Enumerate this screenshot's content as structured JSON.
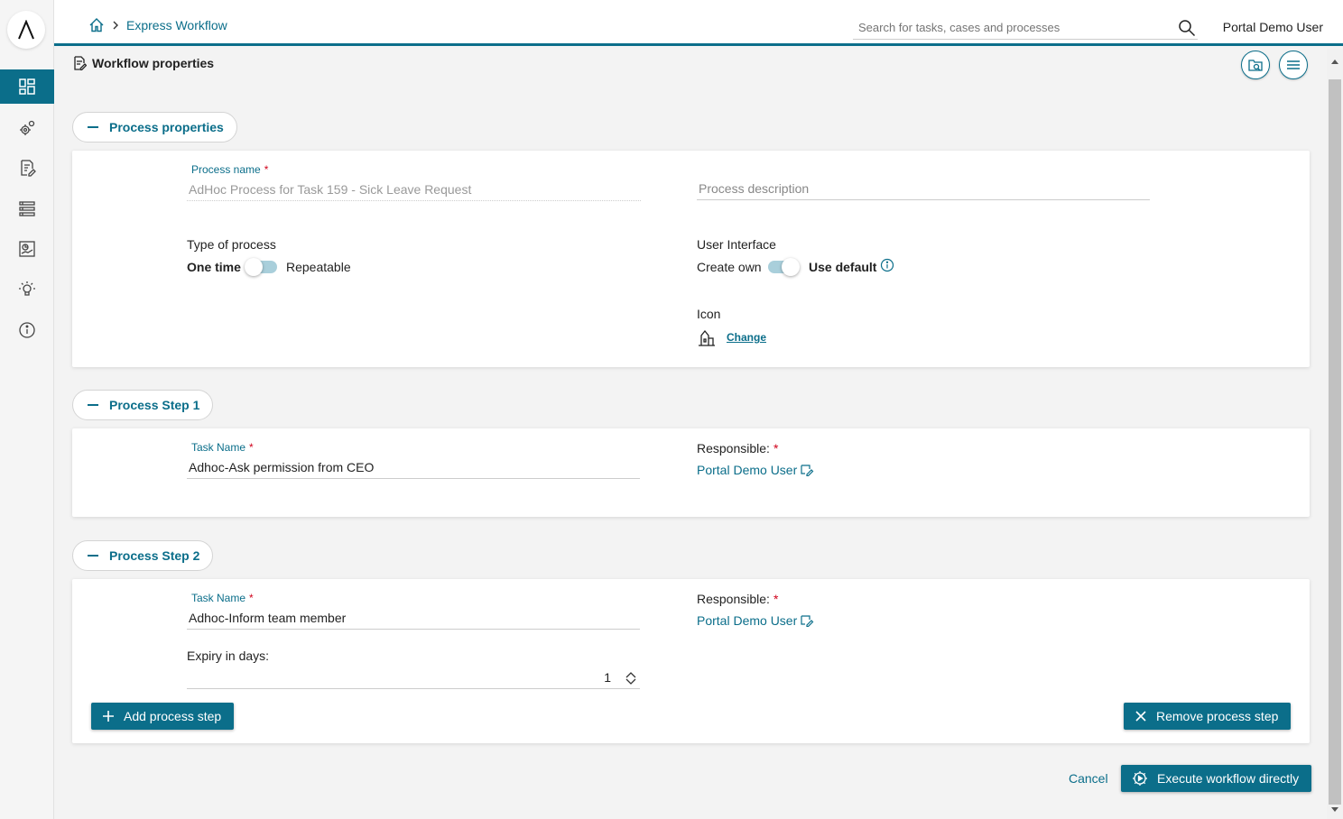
{
  "header": {
    "breadcrumb": "Express Workflow",
    "search_placeholder": "Search for tasks, cases and processes",
    "user": "Portal Demo User"
  },
  "sidebar": {
    "items": [
      {
        "icon": "dashboard-icon",
        "active": true
      },
      {
        "icon": "gears-icon"
      },
      {
        "icon": "task-edit-icon"
      },
      {
        "icon": "list-icon"
      },
      {
        "icon": "statistics-icon"
      },
      {
        "icon": "lightbulb-icon"
      },
      {
        "icon": "info-icon"
      }
    ]
  },
  "page": {
    "title": "Workflow properties"
  },
  "process_properties": {
    "section_label": "Process properties",
    "process_name_label": "Process name",
    "process_name_value": "AdHoc Process for Task 159 - Sick Leave Request",
    "process_description_placeholder": "Process description",
    "type_label": "Type of process",
    "type_option_left": "One time",
    "type_option_right": "Repeatable",
    "ui_label": "User Interface",
    "ui_option_left": "Create own",
    "ui_option_right": "Use default",
    "icon_label": "Icon",
    "change_link": "Change"
  },
  "step1": {
    "section_label": "Process Step 1",
    "task_name_label": "Task Name",
    "task_name_value": "Adhoc-Ask permission from CEO",
    "responsible_label": "Responsible:",
    "responsible_value": "Portal Demo User"
  },
  "step2": {
    "section_label": "Process Step 2",
    "task_name_label": "Task Name",
    "task_name_value": "Adhoc-Inform team member",
    "responsible_label": "Responsible:",
    "responsible_value": "Portal Demo User",
    "expiry_label": "Expiry in days:",
    "expiry_value": "1"
  },
  "actions": {
    "add_step": "Add process step",
    "remove_step": "Remove process step",
    "cancel": "Cancel",
    "execute": "Execute workflow directly"
  },
  "colors": {
    "accent": "#0b6e8a",
    "required": "#d0021b"
  }
}
